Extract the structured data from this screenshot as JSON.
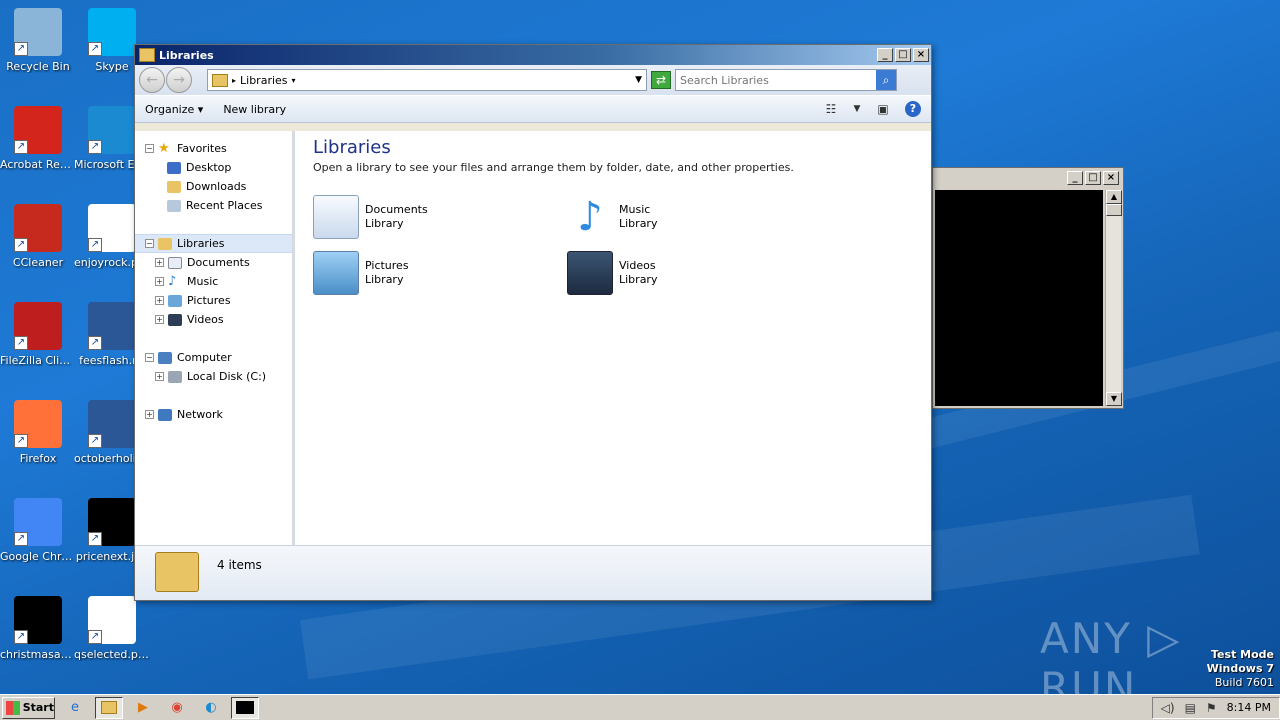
{
  "desktop": {
    "icons": [
      {
        "label": "Recycle Bin",
        "icon": "recycle-bin-icon",
        "color": "#8ab4d8"
      },
      {
        "label": "Skype",
        "icon": "skype-icon",
        "color": "#00aff0"
      },
      {
        "label": "Acrobat Reader DC",
        "icon": "acrobat-icon",
        "color": "#d4251c"
      },
      {
        "label": "Microsoft Edge",
        "icon": "edge-icon",
        "color": "#1b8ad1"
      },
      {
        "label": "CCleaner",
        "icon": "ccleaner-icon",
        "color": "#c62a1f"
      },
      {
        "label": "enjoyrock.png",
        "icon": "image-file-icon",
        "color": "#ffffff"
      },
      {
        "label": "FileZilla Client",
        "icon": "filezilla-icon",
        "color": "#bf1e1e"
      },
      {
        "label": "feesflash.rtf",
        "icon": "word-document-icon",
        "color": "#2b5797"
      },
      {
        "label": "Firefox",
        "icon": "firefox-icon",
        "color": "#ff7139"
      },
      {
        "label": "octoberholiday.rtf",
        "icon": "word-document-icon",
        "color": "#2b5797"
      },
      {
        "label": "Google Chrome",
        "icon": "chrome-icon",
        "color": "#4285f4"
      },
      {
        "label": "pricenext.jpg",
        "icon": "image-file-icon",
        "color": "#000000"
      },
      {
        "label": "christmasad...",
        "icon": "image-file-icon",
        "color": "#000000"
      },
      {
        "label": "qselected.png",
        "icon": "image-file-icon",
        "color": "#ffffff"
      }
    ]
  },
  "explorer": {
    "title": "Libraries",
    "address": "Libraries",
    "search_placeholder": "Search Libraries",
    "toolbar": {
      "organize": "Organize",
      "new_library": "New library"
    },
    "nav": {
      "favorites": "Favorites",
      "favorites_items": [
        "Desktop",
        "Downloads",
        "Recent Places"
      ],
      "libraries": "Libraries",
      "libraries_items": [
        "Documents",
        "Music",
        "Pictures",
        "Videos"
      ],
      "computer": "Computer",
      "computer_items": [
        "Local Disk (C:)"
      ],
      "network": "Network"
    },
    "content": {
      "heading": "Libraries",
      "subtitle": "Open a library to see your files and arrange them by folder, date, and other properties.",
      "libraries": [
        {
          "name": "Documents",
          "type": "Library",
          "icon": "documents-library-icon"
        },
        {
          "name": "Music",
          "type": "Library",
          "icon": "music-library-icon"
        },
        {
          "name": "Pictures",
          "type": "Library",
          "icon": "pictures-library-icon"
        },
        {
          "name": "Videos",
          "type": "Library",
          "icon": "videos-library-icon"
        }
      ]
    },
    "status": "4 items"
  },
  "watermark": {
    "text": "ANY ▷ RUN",
    "line1": "Test Mode",
    "line2": "Windows 7",
    "line3": "Build 7601"
  },
  "taskbar": {
    "start": "Start",
    "clock": "8:14 PM"
  }
}
